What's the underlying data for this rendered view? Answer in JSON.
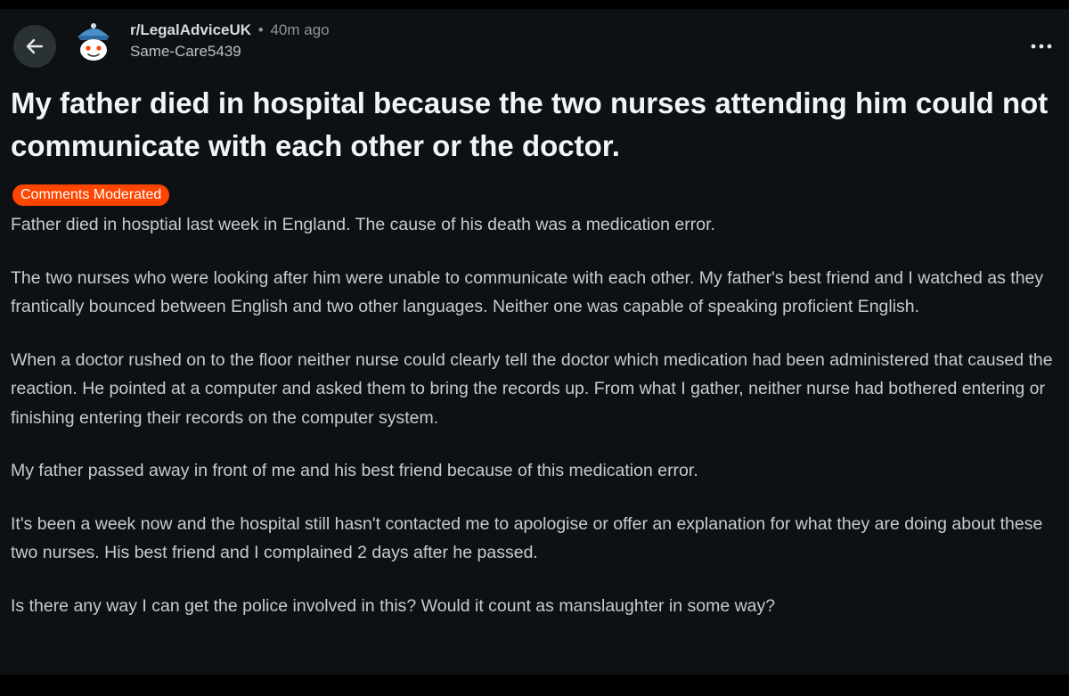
{
  "post": {
    "subreddit": "r/LegalAdviceUK",
    "separator": "•",
    "time_ago": "40m ago",
    "author": "Same-Care5439",
    "title": "My father died in hospital because the two nurses attending him could not communicate with each other or the doctor.",
    "flair": "Comments Moderated",
    "paragraphs": [
      "Father died in hosptial last week in England. The cause of his death was a medication error.",
      "The two nurses who were looking after him were unable to communicate with each other. My father's best friend and I watched as they frantically bounced between English and two other languages. Neither one was capable of speaking proficient English.",
      "When a doctor rushed on to the floor neither nurse could clearly tell the doctor which medication had been administered that caused the reaction. He pointed at a computer and asked them to bring the records up. From what I gather, neither nurse had bothered entering or finishing entering their records on the computer system.",
      "My father passed away in front of me and his best friend because of this medication error.",
      "It's been a week now and the hospital still hasn't contacted me to apologise or offer an explanation for what they are doing about these two nurses. His best friend and I complained 2 days after he passed.",
      "Is there any way I can get the police involved in this? Would it count as manslaughter in some way?"
    ]
  },
  "icons": {
    "back": "arrow-left-icon",
    "avatar": "snoo-avatar",
    "more": "more-horizontal-icon"
  },
  "colors": {
    "background": "#0e1113",
    "flair_bg": "#ff4500",
    "title_text": "#f2f4f5",
    "body_text": "#c5ccd0",
    "muted": "#8a9599"
  }
}
